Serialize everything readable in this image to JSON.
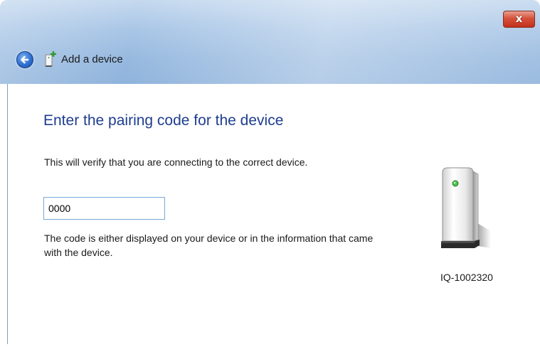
{
  "window": {
    "title": "Add a device",
    "close_label": "x"
  },
  "icons": {
    "back": "back-arrow-icon",
    "title": "bluetooth-device-icon",
    "device": "device-tower-icon"
  },
  "main": {
    "heading": "Enter the pairing code for the device",
    "description": "This will verify that you are connecting to the correct device.",
    "code_value": "0000",
    "hint": "The code is either displayed on your device or in the information that came with the device.",
    "device_name": "IQ-1002320"
  },
  "colors": {
    "heading": "#1e3d8f",
    "titlebar": "#a9c6e6",
    "close_button": "#c2301a"
  }
}
